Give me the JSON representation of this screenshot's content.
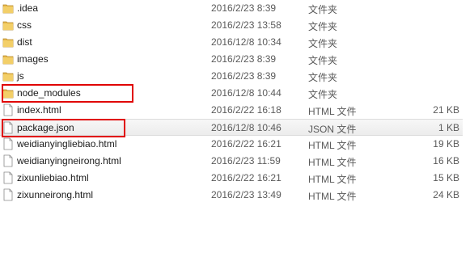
{
  "files": [
    {
      "name": ".idea",
      "date": "2016/2/23 8:39",
      "type": "文件夹",
      "size": "",
      "icon": "folder-icon"
    },
    {
      "name": "css",
      "date": "2016/2/23 13:58",
      "type": "文件夹",
      "size": "",
      "icon": "folder-icon"
    },
    {
      "name": "dist",
      "date": "2016/12/8 10:34",
      "type": "文件夹",
      "size": "",
      "icon": "folder-icon"
    },
    {
      "name": "images",
      "date": "2016/2/23 8:39",
      "type": "文件夹",
      "size": "",
      "icon": "folder-icon"
    },
    {
      "name": "js",
      "date": "2016/2/23 8:39",
      "type": "文件夹",
      "size": "",
      "icon": "folder-icon"
    },
    {
      "name": "node_modules",
      "date": "2016/12/8 10:44",
      "type": "文件夹",
      "size": "",
      "icon": "folder-icon"
    },
    {
      "name": "index.html",
      "date": "2016/2/22 16:18",
      "type": "HTML 文件",
      "size": "21 KB",
      "icon": "file-icon"
    },
    {
      "name": "package.json",
      "date": "2016/12/8 10:46",
      "type": "JSON 文件",
      "size": "1 KB",
      "icon": "file-icon"
    },
    {
      "name": "weidianyingliebiao.html",
      "date": "2016/2/22 16:21",
      "type": "HTML 文件",
      "size": "19 KB",
      "icon": "file-icon"
    },
    {
      "name": "weidianyingneirong.html",
      "date": "2016/2/23 11:59",
      "type": "HTML 文件",
      "size": "16 KB",
      "icon": "file-icon"
    },
    {
      "name": "zixunliebiao.html",
      "date": "2016/2/22 16:21",
      "type": "HTML 文件",
      "size": "15 KB",
      "icon": "file-icon"
    },
    {
      "name": "zixunneirong.html",
      "date": "2016/2/23 13:49",
      "type": "HTML 文件",
      "size": "24 KB",
      "icon": "file-icon"
    }
  ],
  "selected_index": 7,
  "colors": {
    "highlight": "#e00000",
    "folder": "#e8b84a"
  }
}
